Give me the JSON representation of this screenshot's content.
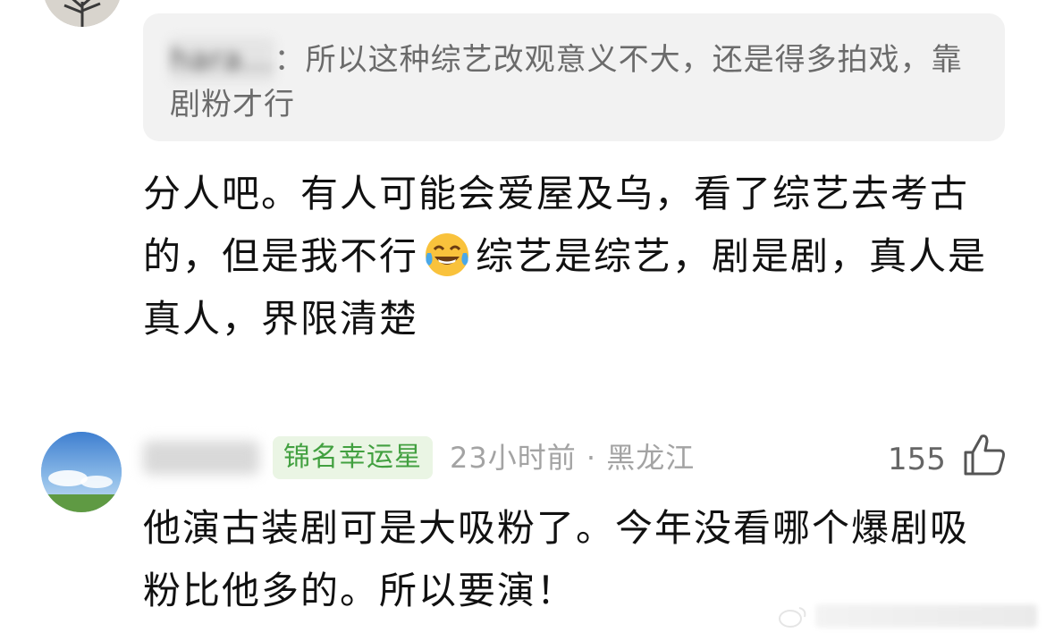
{
  "quoted_comment": {
    "author_blurred": "hara...",
    "separator": "：",
    "text": "所以这种综艺改观意义不大，还是得多拍戏，靠剧粉才行"
  },
  "reply_comment": {
    "part1": "分人吧。有人可能会爱屋及乌，看了综艺去考古的，但是我不行",
    "emoji": "laughing-crying-emoji",
    "part2": "综艺是综艺，剧是剧，真人是真人，界限清楚"
  },
  "comment2": {
    "badge": "锦名幸运星",
    "time": "23小时前",
    "dot": "·",
    "location": "黑龙江",
    "likes": "155",
    "text": "他演古装剧可是大吸粉了。今年没看哪个爆剧吸粉比他多的。所以要演！"
  },
  "colors": {
    "badge_green": "#42a040",
    "meta_gray": "#a3a3a3",
    "quote_bg": "#f2f2f2"
  }
}
